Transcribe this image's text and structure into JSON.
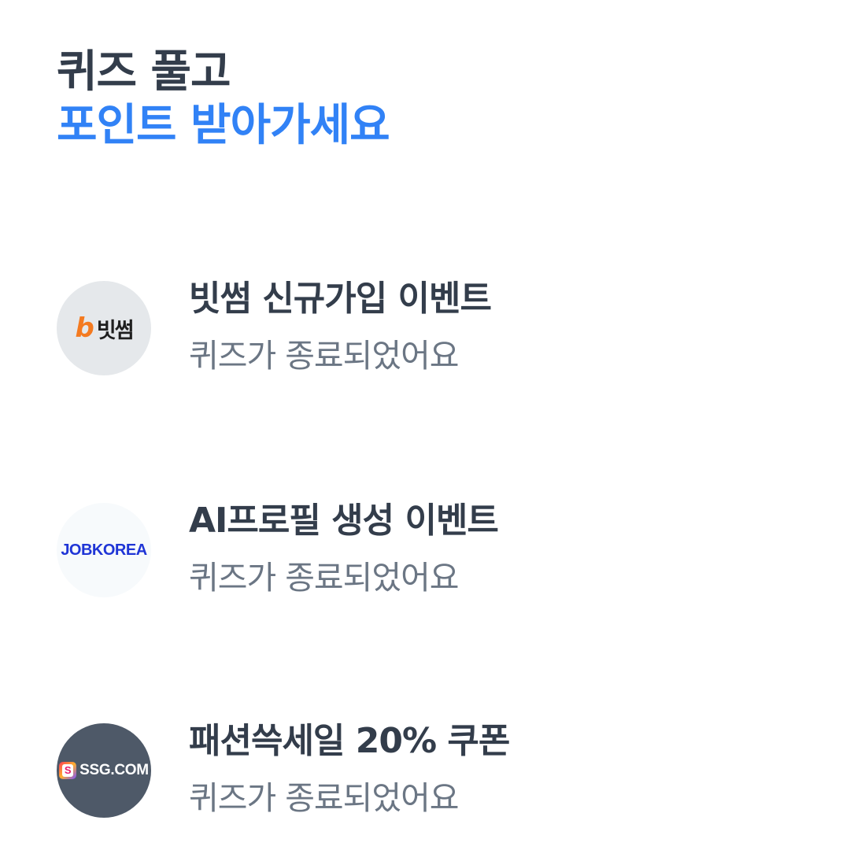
{
  "header": {
    "title_line1": "퀴즈 풀고",
    "title_line2": "포인트 받아가세요"
  },
  "events": [
    {
      "logo_icon": "bitsum-logo",
      "logo_mark": "b",
      "logo_text": "빗썸",
      "title": "빗썸 신규가입 이벤트",
      "status": "퀴즈가 종료되었어요"
    },
    {
      "logo_icon": "jobkorea-logo",
      "logo_text": "JOBKOREA",
      "title": "AI프로필 생성 이벤트",
      "status": "퀴즈가 종료되었어요"
    },
    {
      "logo_icon": "ssg-logo",
      "logo_mark": "S",
      "logo_text": "SSG.COM",
      "title": "패션쓱세일 20% 쿠폰",
      "status": "퀴즈가 종료되었어요"
    }
  ],
  "colors": {
    "title_dark": "#333d4b",
    "accent_blue": "#3182f6",
    "status_gray": "#6b7684",
    "bitsum_orange": "#f47a20",
    "jobkorea_blue": "#1f35d6",
    "ssg_bg": "#4e5968"
  }
}
